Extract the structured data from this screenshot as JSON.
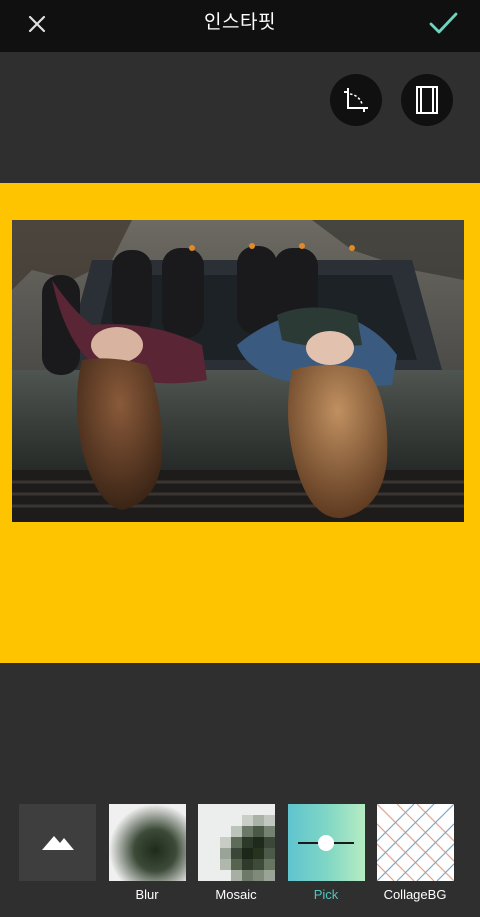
{
  "header": {
    "title": "인스타핏",
    "close_icon": "close-icon",
    "confirm_icon": "checkmark-icon",
    "confirm_color": "#6fd3c0"
  },
  "tools": [
    {
      "icon": "crop-rotate-icon"
    },
    {
      "icon": "aspect-ratio-icon"
    }
  ],
  "canvas": {
    "background_color": "#ffc400"
  },
  "backgrounds": {
    "items": [
      {
        "label": "",
        "icon": "image-mountain-icon"
      },
      {
        "label": "Blur",
        "icon": "blur-preview"
      },
      {
        "label": "Mosaic",
        "icon": "mosaic-preview"
      },
      {
        "label": "Pick",
        "icon": "color-pick-slider",
        "selected": true
      },
      {
        "label": "CollageBG",
        "icon": "collage-pattern-preview"
      }
    ],
    "selected_label_color": "#4cc7c0"
  }
}
